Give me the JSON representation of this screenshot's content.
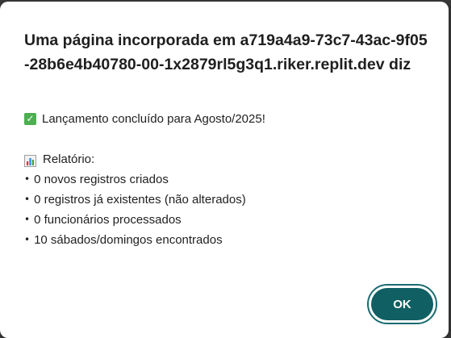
{
  "dialog": {
    "title": "Uma página incorporada em a719a4a9-73c7-43ac-9f05-28b6e4b40780-00-1x2879rl5g3q1.riker.replit.dev diz",
    "message": {
      "headline": "Lançamento concluído para Agosto/2025!",
      "report_heading": "Relatório:",
      "bullets": [
        "0 novos registros criados",
        "0 registros já existentes (não alterados)",
        "0 funcionários processados",
        "10 sábados/domingos encontrados"
      ],
      "bullet_char": "•"
    },
    "ok_label": "OK"
  },
  "icons": {
    "headline_icon": "check-mark-button-icon",
    "report_icon": "bar-chart-icon"
  },
  "colors": {
    "button_bg": "#0f5f63",
    "button_ring": "#1b6b6f",
    "check_green": "#4caf50"
  }
}
